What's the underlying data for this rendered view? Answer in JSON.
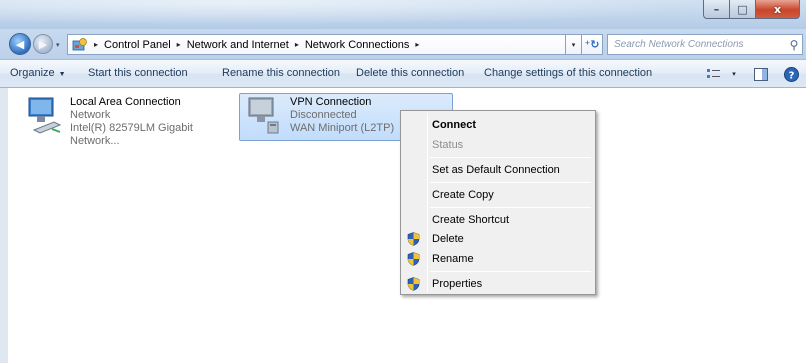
{
  "window": {
    "controls": {
      "minimize": "–",
      "maximize": "□",
      "close": "x"
    }
  },
  "address": {
    "recent_arrow": "▾",
    "breadcrumbs": [
      "Control Panel",
      "Network and Internet",
      "Network Connections"
    ],
    "trailing_sep": "▸",
    "dropdown_arrow": "▾",
    "refresh": "⁺↻",
    "search_placeholder": "Search Network Connections"
  },
  "toolbar": {
    "organize": "Organize",
    "start": "Start this connection",
    "rename": "Rename this connection",
    "delete": "Delete this connection",
    "change": "Change settings of this connection",
    "view_dropdown": "▾"
  },
  "connections": [
    {
      "name": "Local Area Connection",
      "status": "Network",
      "device": "Intel(R) 82579LM Gigabit Network..."
    },
    {
      "name": "VPN Connection",
      "status": "Disconnected",
      "device": "WAN Miniport (L2TP)",
      "selected": true
    }
  ],
  "context_menu": {
    "items": [
      {
        "label": "Connect",
        "bold": true
      },
      {
        "label": "Status",
        "disabled": true
      },
      {
        "label": "Set as Default Connection"
      },
      {
        "label": "Create Copy"
      },
      {
        "label": "Create Shortcut"
      },
      {
        "label": "Delete",
        "shield": true
      },
      {
        "label": "Rename",
        "shield": true
      },
      {
        "label": "Properties",
        "shield": true
      }
    ]
  },
  "colors": {
    "selection": "#c1dcfc",
    "selection_border": "#7da2ce",
    "command_text": "#1e395b",
    "shield_blue": "#2d62b8",
    "shield_yellow": "#f2c335"
  }
}
